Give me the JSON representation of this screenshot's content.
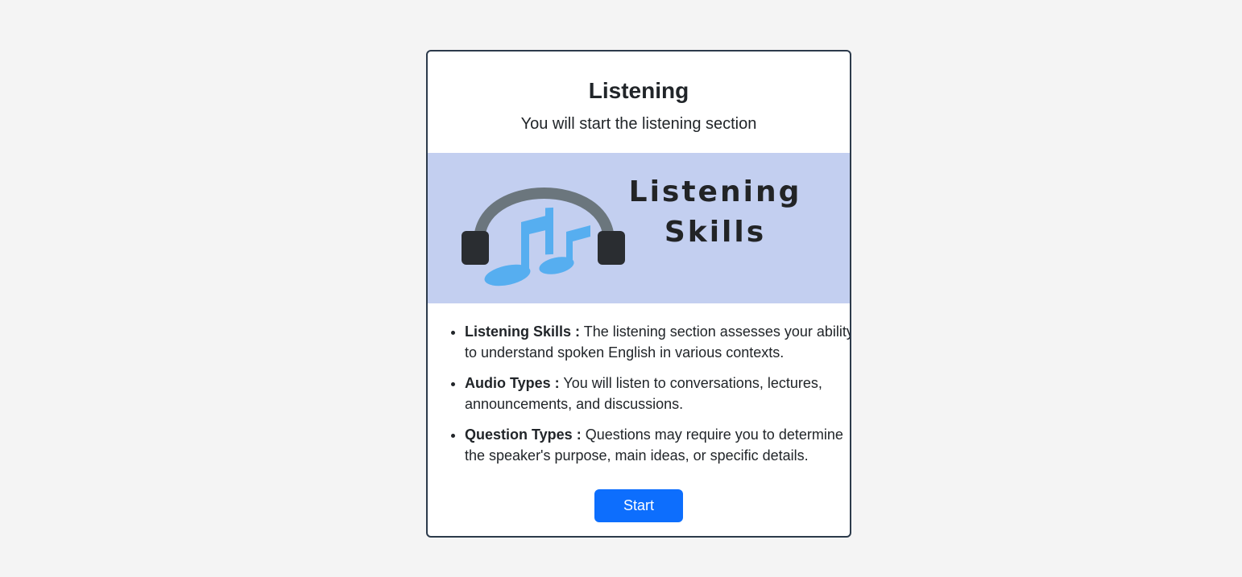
{
  "card": {
    "title": "Listening",
    "subtitle": "You will start the listening section"
  },
  "banner": {
    "line1": "Listening",
    "line2": "Skills",
    "icon": "headphones-music-icon",
    "colors": {
      "background": "#c3cff0",
      "headband": "#6b767d",
      "earcups": "#2a2d31",
      "notes": "#56aef0"
    }
  },
  "info": [
    {
      "label": "Listening Skills :",
      "text": "The listening section assesses your ability to understand spoken English in various contexts."
    },
    {
      "label": "Audio Types :",
      "text": "You will listen to conversations, lectures, announcements, and discussions."
    },
    {
      "label": "Question Types :",
      "text": "Questions may require you to determine the speaker's purpose, main ideas, or specific details."
    }
  ],
  "start_button": {
    "label": "Start",
    "color": "#0d6efd"
  }
}
